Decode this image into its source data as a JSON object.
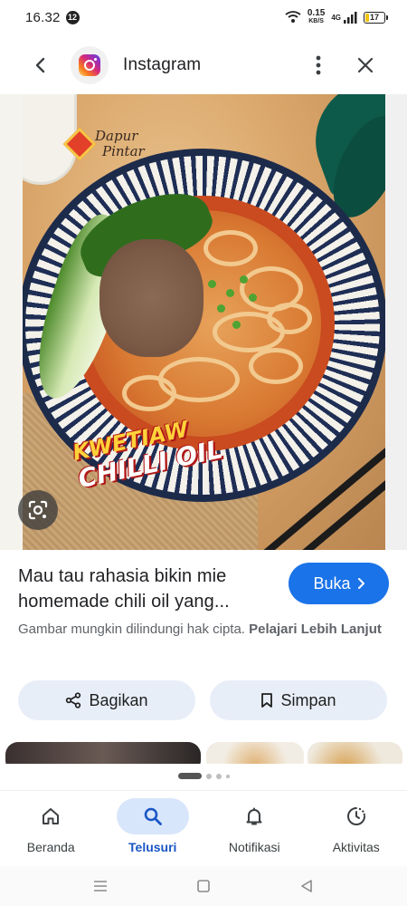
{
  "status_bar": {
    "time": "16.32",
    "notification_count": "12",
    "speed_value": "0.15",
    "speed_unit": "KB/S",
    "network": "4G",
    "battery": "17"
  },
  "header": {
    "title": "Instagram",
    "source_icon": "instagram-logo"
  },
  "image": {
    "brand_line1": "Dapur",
    "brand_line2": "Pintar",
    "label_line1": "KWETIAW",
    "label_line2": "CHILLI OIL"
  },
  "result": {
    "title": "Mau tau rahasia bikin mie homemade chili oil yang...",
    "open_label": "Buka",
    "copyright_text": "Gambar mungkin dilindungi hak cipta.",
    "learn_more": "Pelajari Lebih Lanjut"
  },
  "actions": {
    "share_label": "Bagikan",
    "save_label": "Simpan"
  },
  "bottom_nav": {
    "items": [
      {
        "label": "Beranda",
        "icon": "home-icon",
        "active": false
      },
      {
        "label": "Telusuri",
        "icon": "search-icon",
        "active": true
      },
      {
        "label": "Notifikasi",
        "icon": "bell-icon",
        "active": false
      },
      {
        "label": "Aktivitas",
        "icon": "activity-icon",
        "active": false
      }
    ]
  },
  "colors": {
    "accent": "#1a73e8",
    "chip_bg": "#e8eef8",
    "active_nav_bg": "#d8e6fb",
    "active_nav_text": "#1a56c4"
  }
}
